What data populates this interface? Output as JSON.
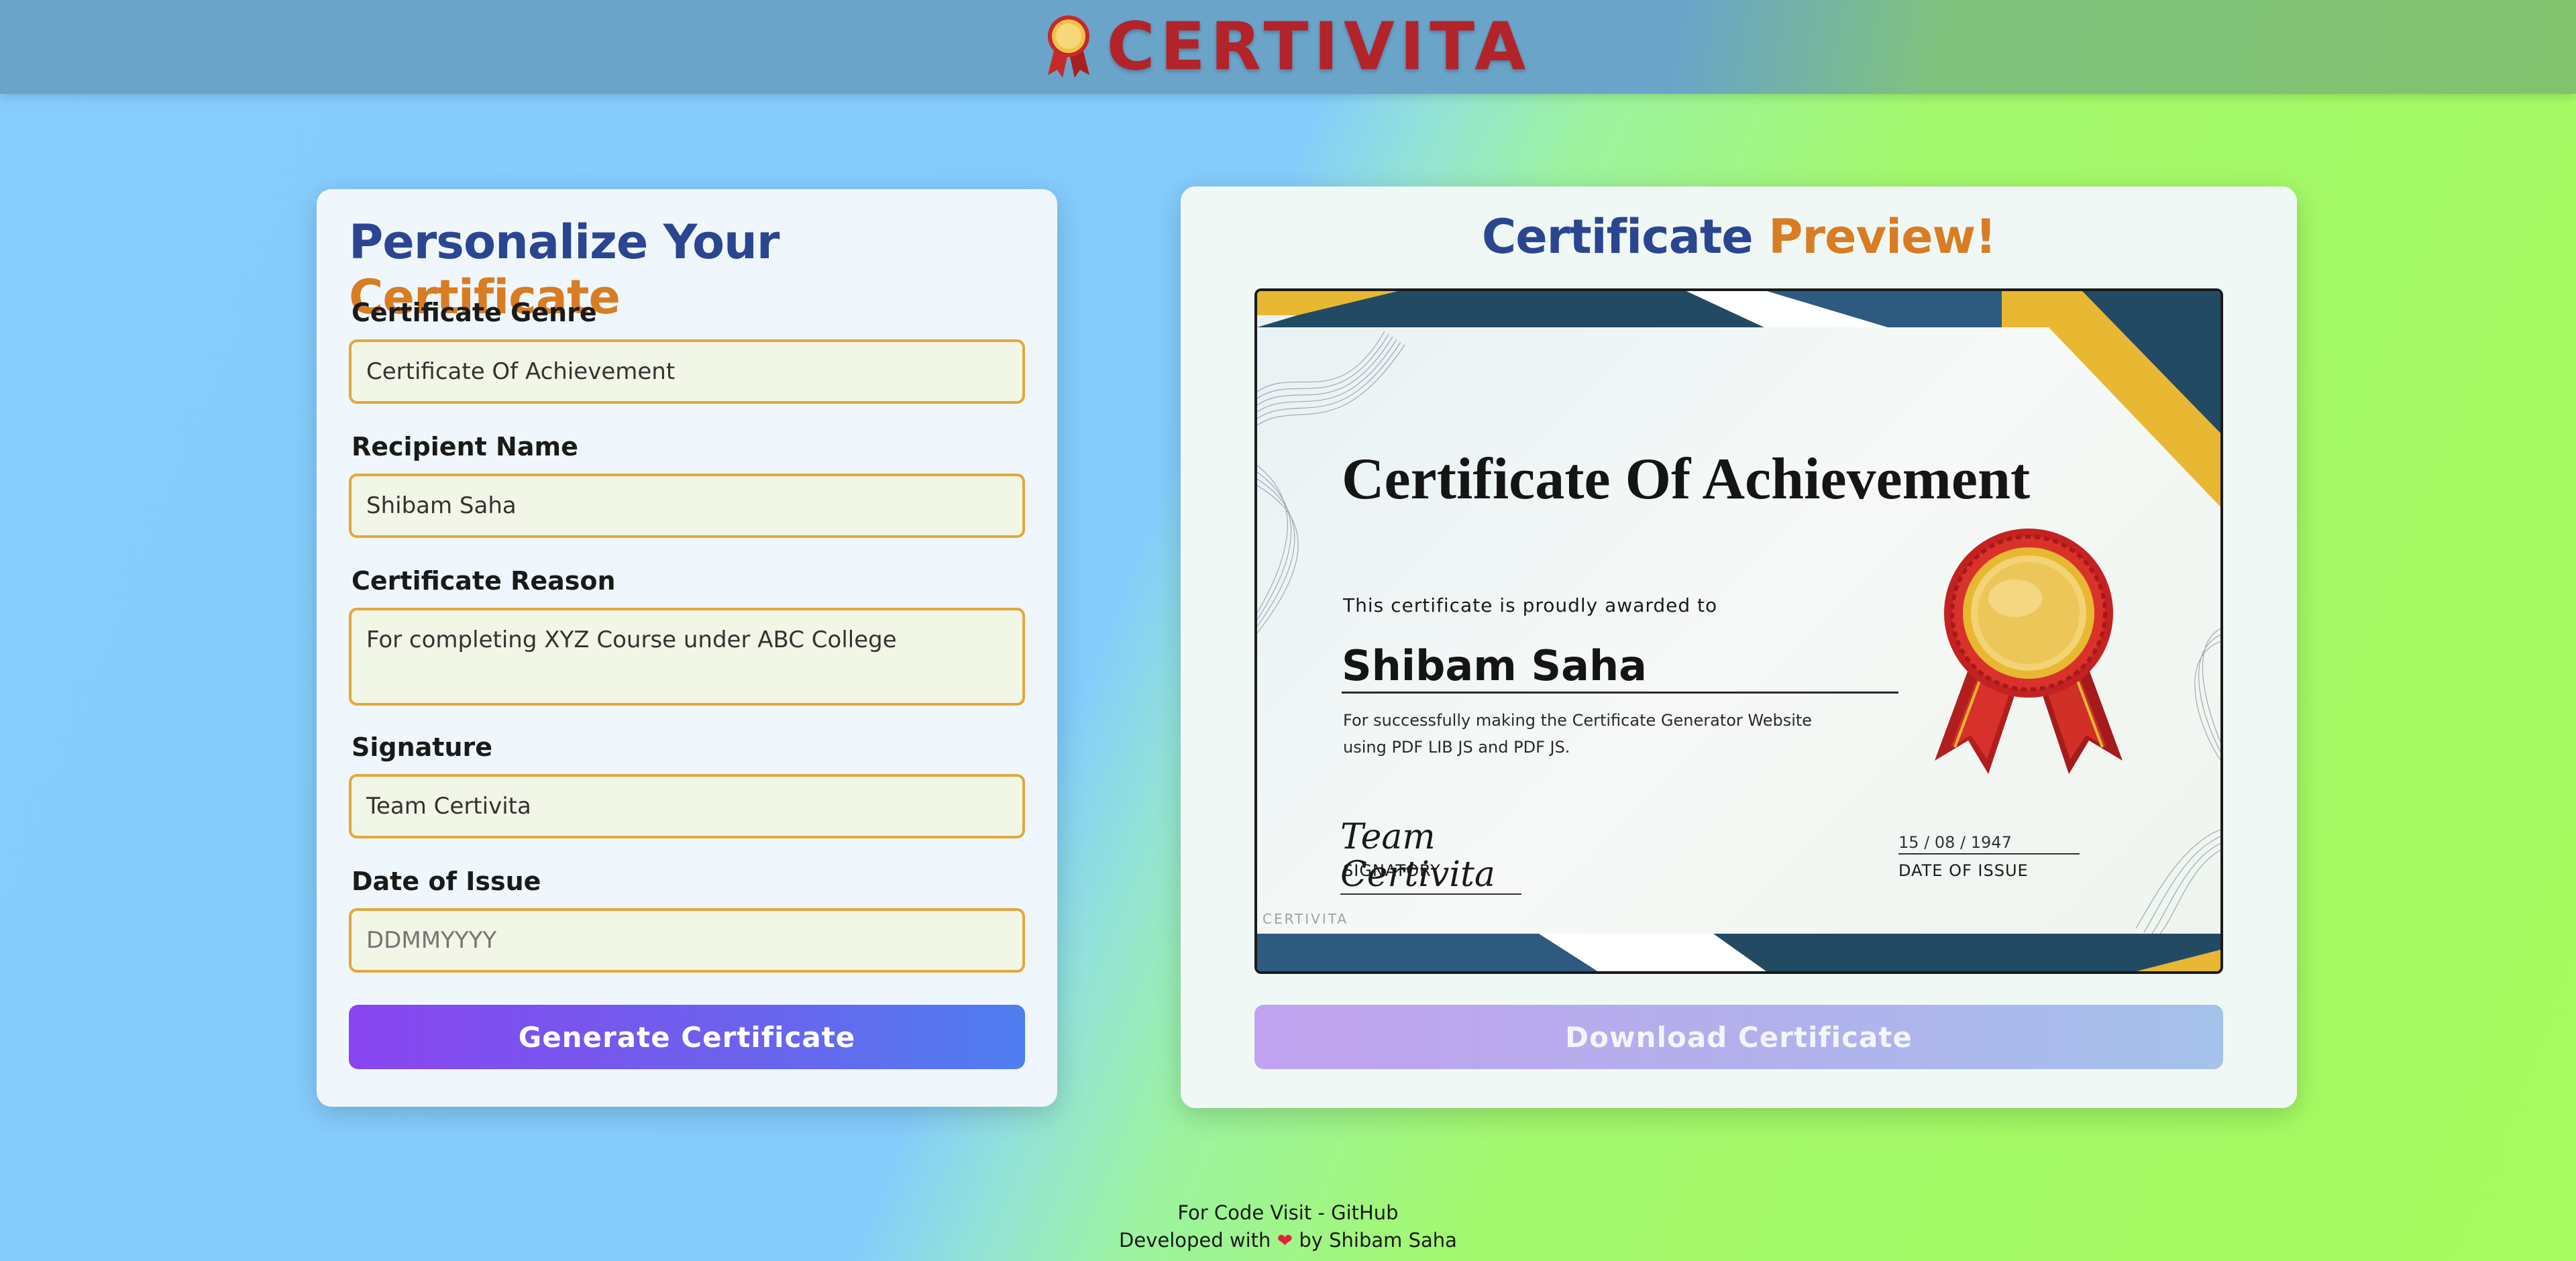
{
  "header": {
    "brand": "CERTIVITA",
    "logo_icon": "ribbon-medal-icon"
  },
  "form": {
    "title_part1": "Personalize Your",
    "title_part2": "Certificate",
    "fields": {
      "genre": {
        "label": "Certificate Genre",
        "value": "Certificate Of Achievement"
      },
      "recipient": {
        "label": "Recipient Name",
        "value": "Shibam Saha"
      },
      "reason": {
        "label": "Certificate Reason",
        "value": "For completing XYZ Course under ABC College"
      },
      "signature": {
        "label": "Signature",
        "value": "Team Certivita"
      },
      "date": {
        "label": "Date of Issue",
        "placeholder": "DDMMYYYY"
      }
    },
    "generate_label": "Generate Certificate"
  },
  "preview": {
    "title_part1": "Certificate",
    "title_part2": "Preview!",
    "download_label": "Download Certificate",
    "certificate": {
      "title": "Certificate Of Achievement",
      "awarded_text": "This certificate is proudly awarded to",
      "recipient": "Shibam Saha",
      "reason_line1": "For successfully making the Certificate Generator Website",
      "reason_line2": "using PDF LIB JS and PDF JS.",
      "signature": "Team Certivita",
      "signatory_label": "SIGNATORY",
      "date": "15 / 08 / 1947",
      "date_label": "DATE OF ISSUE",
      "watermark": "CERTIVITA",
      "medal_icon": "gold-medal-ribbon-icon"
    }
  },
  "footer": {
    "line1_prefix": "For Code Visit - ",
    "github_link": "GitHub",
    "line2_prefix": "Developed with",
    "heart_icon": "heart-icon",
    "line2_suffix": "by Shibam Saha"
  },
  "colors": {
    "brand_red": "#b3232a",
    "title_blue": "#2b4690",
    "title_orange": "#d87d23",
    "input_border": "#e4a73a",
    "cert_navy": "#234a63",
    "cert_gold": "#e8b832"
  }
}
